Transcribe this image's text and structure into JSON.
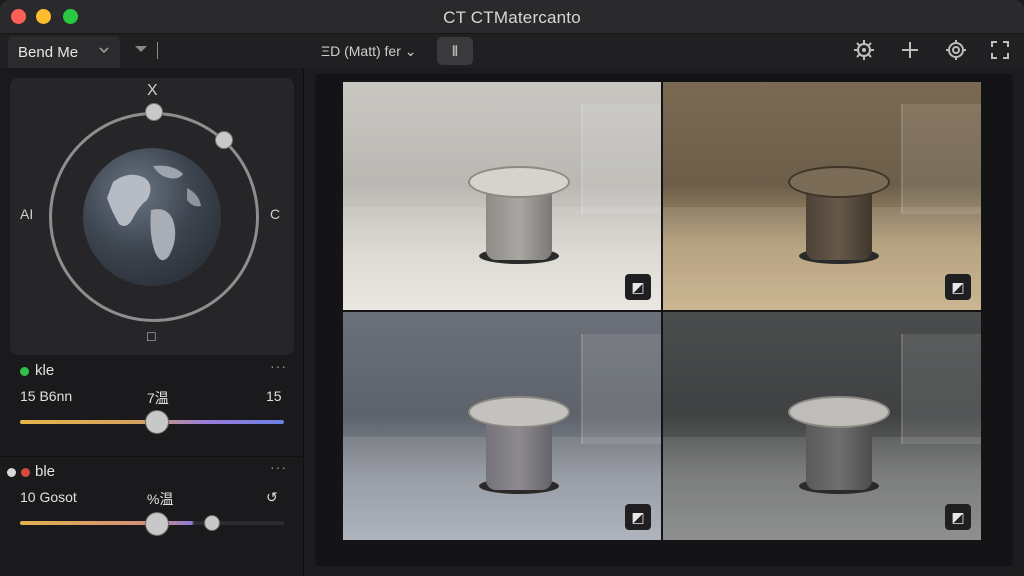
{
  "window": {
    "title": "CT CTMatercanto"
  },
  "sidebar": {
    "tab_label": "Bend Me",
    "compass": {
      "top": "X",
      "left": "AI",
      "right": "C",
      "bottom": "□"
    },
    "control_a": {
      "label": "kle",
      "left_value": "15 B6nn",
      "mid_value": "7温",
      "right_value": "15"
    },
    "control_b": {
      "label": "ble",
      "left_value": "10 Gosot",
      "mid_value": "%温",
      "right_value": "↺"
    },
    "more_label": "···"
  },
  "toolbar": {
    "view_selector": "ΞD (Matt) fer ⌄",
    "view_button": "⦀"
  },
  "tiles": [
    {
      "badge": "◩"
    },
    {
      "badge": "◩"
    },
    {
      "badge": "◩"
    },
    {
      "badge": "◩"
    }
  ],
  "icons": {
    "settings": "gear-icon",
    "add": "plus-icon",
    "preferences": "cog-icon",
    "fullscreen": "expand-icon"
  }
}
